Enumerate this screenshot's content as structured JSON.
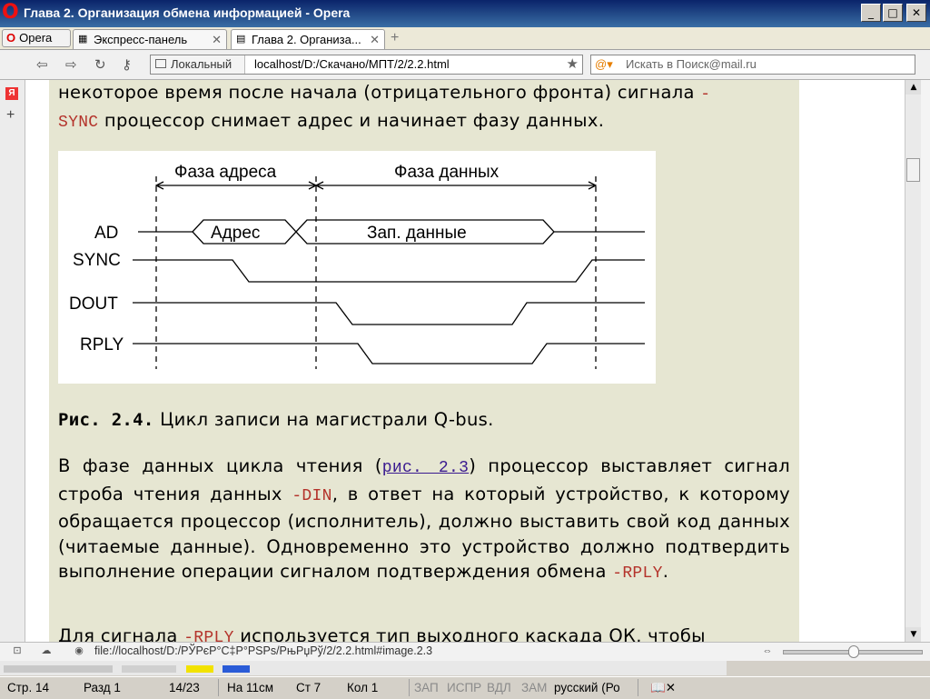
{
  "window": {
    "title": "Глава 2. Организация обмена информацией - Opera",
    "minimize": "_",
    "maximize": "□",
    "close": "✕"
  },
  "tabs": {
    "menu_label": "Opera",
    "items": [
      {
        "label": "Экспресс-панель",
        "icon": "grid-icon",
        "close": "✕"
      },
      {
        "label": "Глава 2. Организа...",
        "icon": "page-icon",
        "close": "✕"
      }
    ],
    "new_tab": "+"
  },
  "address": {
    "zone_label": "Локальный",
    "url": "localhost/D:/Скачано/МПТ/2/2.2.html",
    "search_placeholder": "Искать в Поиск@mail.ru"
  },
  "sidebar": {
    "logo": "Я",
    "add": "+"
  },
  "content": {
    "intro_plain": "некоторое время после начала (отрицательного фронта) сигнала ",
    "intro_code1": "-",
    "intro_code2": "SYNC",
    "intro_tail": " процессор снимает адрес и начинает фазу данных.",
    "caption_bold": "Рис. 2.4.",
    "caption_text": " Цикл записи на магистрали Q-bus.",
    "p2_a": "В фазе данных цикла чтения (",
    "p2_link": "рис. 2.3",
    "p2_b": ") процессор выставляет сигнал строба чтения данных ",
    "p2_code1": "-DIN",
    "p2_c": ", в ответ на который устройство, к которому обращается процессор (исполнитель), должно выставить свой код данных (читаемые данные). Одновременно это устройство должно подтвердить выполнение операции сигналом подтверждения обмена ",
    "p2_code2": "-RPLY",
    "p2_d": ".",
    "p3_a": "Для сигнала ",
    "p3_code": "-RPLY",
    "p3_b": " используется тип выходного каскада ОК, чтобы"
  },
  "figure": {
    "phase_address": "Фаза адреса",
    "phase_data": "Фаза данных",
    "signals": [
      "AD",
      "SYNC",
      "DOUT",
      "RPLY"
    ],
    "ad_address": "Адрес",
    "ad_data": "Зап. данные"
  },
  "status": {
    "url": "file://localhost/D:/РЎРєР°С‡Р°РЅРѕ/РњРџРў/2/2.2.html#image.2.3"
  },
  "word": {
    "page": "Стр. 14",
    "section": "Разд 1",
    "pages": "14/23",
    "at": "На 11см",
    "line": "Ст 7",
    "col": "Кол 1",
    "rec": "ЗАП",
    "trk": "ИСПР",
    "ext": "ВДЛ",
    "ovr": "ЗАМ",
    "lang": "русский (Ро"
  },
  "colors": {
    "page_bg": "#e6e6d2",
    "code": "#b4332b",
    "link": "#3a1a8f"
  }
}
